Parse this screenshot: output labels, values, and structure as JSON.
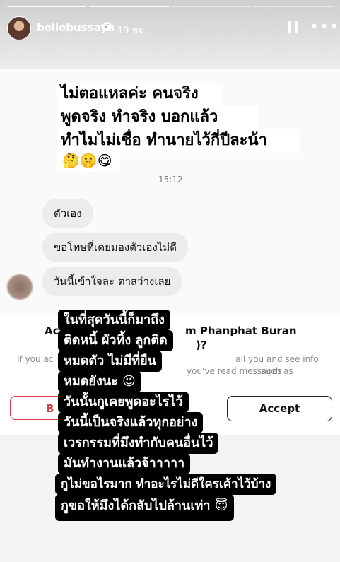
{
  "header": {
    "username": "bellebussaya",
    "time_ago": "19 ชม.",
    "more_label": "•••"
  },
  "caption_lines": [
    "ไม่ตอแหลค่ะ คนจริง",
    "พูดจริง ทำจริง บอกแล้ว",
    "ทำไมไม่เชื่อ ทำนายไว้กี่ปีละน้า"
  ],
  "caption_emojis": "🤔🤫😋",
  "chat": {
    "time": "15:12",
    "messages": [
      "ตัวเอง",
      "ขอโทษที่เคยมองตัวเองไม่ดี",
      "วันนี้เข้าใจละ ตาสว่างเลย"
    ]
  },
  "request": {
    "title_left": "Ac",
    "title_right": "m Phanphat Buran",
    "title_end": ")?",
    "desc_left1": "If you ac",
    "desc_right1": "all you and see info such as",
    "desc_right2": "you've read messages.",
    "block_label": "B",
    "accept_label": "Accept"
  },
  "overlay_lines": [
    "ในที่สุดวันนี้ก็มาถึง",
    "ติดหนี้ ผัวทิ้ง ลูกติด",
    "หมดตัว ไม่มีที่ยืน",
    "หมดยังนะ 😉",
    "วันนั้นกูเคยพูดอะไรไว้",
    "วันนี้เป็นจริงแล้วทุกอย่าง",
    "เวรกรรมที่มึงทำกับคนอื่นไว้",
    "มันทำงานแล้วจ้าาาาา",
    "กูไม่ขอไรมาก ทำอะไรไม่ดีใครเค้าไว้บ้าง",
    "กูขอให้มึงได้กลับไปล้านเท่า 😇"
  ]
}
